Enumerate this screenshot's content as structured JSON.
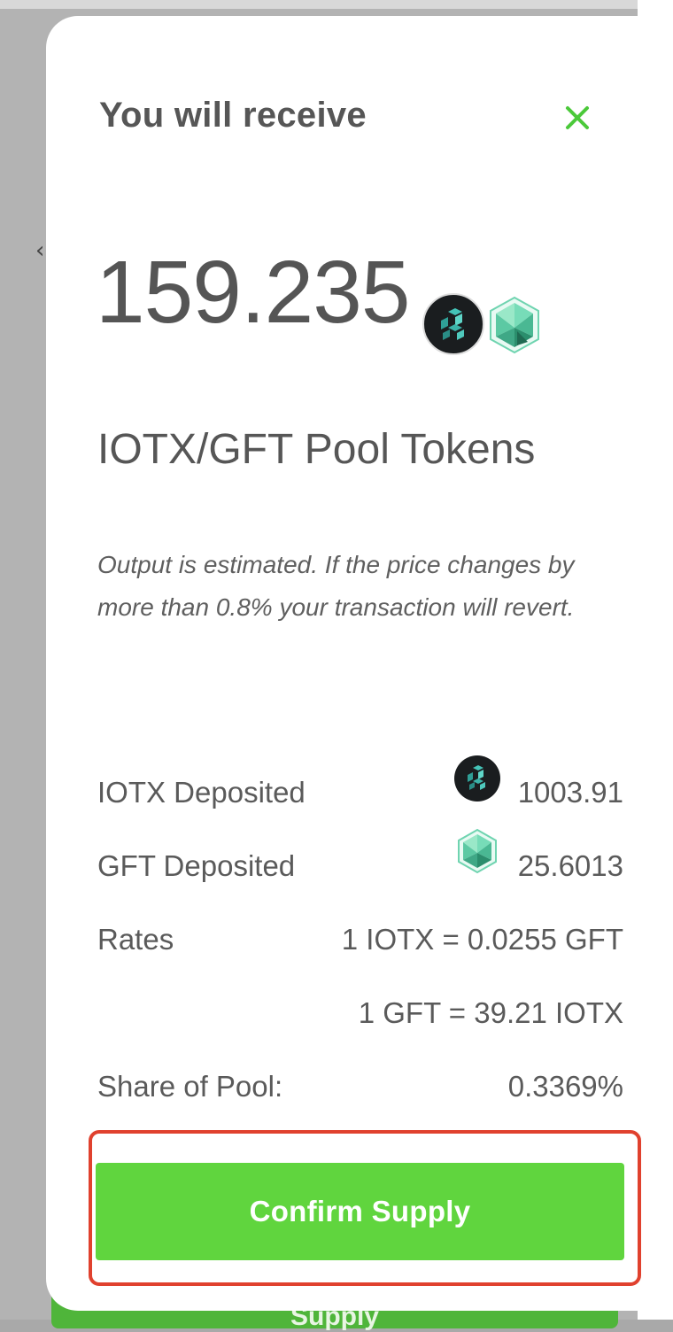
{
  "background": {
    "supply_label": "Supply",
    "chevron": "‹"
  },
  "modal": {
    "title": "You will receive",
    "close_icon": "close-icon",
    "amount": "159.235",
    "pool_tokens": "IOTX/GFT Pool Tokens",
    "note": "Output is estimated. If the price changes by more than 0.8% your transaction will revert.",
    "rows": {
      "iotx_deposited_label": "IOTX Deposited",
      "iotx_deposited_value": "1003.91",
      "gft_deposited_label": "GFT Deposited",
      "gft_deposited_value": "25.6013",
      "rates_label": "Rates",
      "rate_1": "1 IOTX = 0.0255 GFT",
      "rate_2": "1 GFT = 39.21 IOTX",
      "share_label": "Share of Pool:",
      "share_value": "0.3369%"
    },
    "confirm_label": "Confirm Supply"
  },
  "colors": {
    "accent_green": "#60d53e",
    "close_green": "#4bc93a",
    "highlight_red": "#e0412e",
    "text_gray": "#565656"
  }
}
